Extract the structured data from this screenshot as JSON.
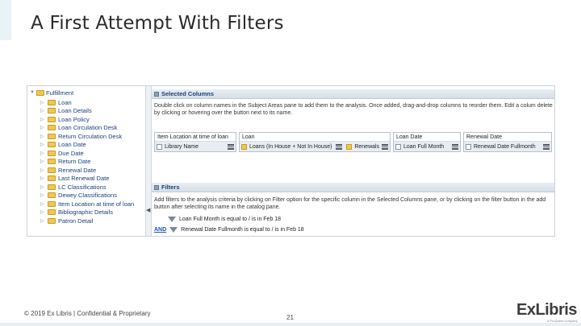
{
  "slide": {
    "title": "A First Attempt With Filters",
    "footer": "© 2019 Ex Libris | Confidential & Proprietary",
    "page_number": "21",
    "logo": "ExLibris",
    "logo_sub": "a ProQuest company"
  },
  "tree": {
    "root_label": "Fulfillment",
    "items": [
      "Loan",
      "Loan Details",
      "Loan Policy",
      "Loan Circulation Desk",
      "Return Circulation Desk",
      "Loan Date",
      "Due Date",
      "Return Date",
      "Renewal Date",
      "Last Renewal Date",
      "LC Classifications",
      "Dewey Classifications",
      "Item Location at time of loan",
      "Bibliographic Details",
      "Patron Detail"
    ]
  },
  "selected_columns": {
    "header": "Selected Columns",
    "instructions": "Double click on column names in the Subject Areas pane to add them to the analysis. Once added, drag-and-drop columns to reorder them. Edit a colum delete by clicking or hovering over the button next to its name.",
    "columns": [
      {
        "head": "Item Location at time of loan",
        "value": "Library Name"
      },
      {
        "head": "Loan",
        "value": "Loans (In House + Not In House)"
      },
      {
        "head": "",
        "value": "Renewals"
      },
      {
        "head": "Loan Date",
        "value": "Loan Full Month"
      },
      {
        "head": "Renewal Date",
        "value": "Renewal Date Fullmonth"
      }
    ]
  },
  "filters": {
    "header": "Filters",
    "instructions": "Add filters to the analysis criteria by clicking on Filter option for the specific column in the Selected Columns pane, or by clicking on the filter button in the add button after selecting its name in the catalog pane.",
    "conditions": [
      {
        "operator": "",
        "text": "Loan Full Month is equal to / is in  Feb 18"
      },
      {
        "operator": "AND",
        "text": "Renewal Date Fullmonth is equal to / is in  Feb 18"
      }
    ]
  }
}
